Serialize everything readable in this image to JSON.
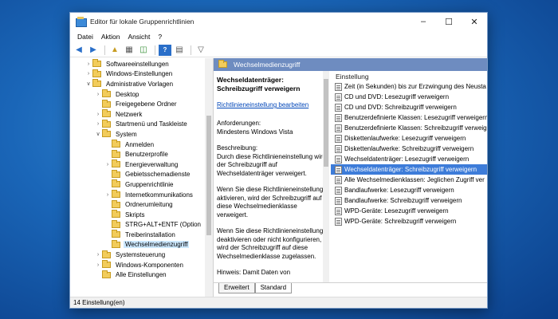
{
  "window": {
    "title": "Editor für lokale Gruppenrichtlinien"
  },
  "menu": [
    "Datei",
    "Aktion",
    "Ansicht",
    "?"
  ],
  "tree": [
    {
      "label": "Softwareeinstellungen",
      "indent": 1,
      "arrow": ">",
      "selected": false
    },
    {
      "label": "Windows-Einstellungen",
      "indent": 1,
      "arrow": ">",
      "selected": false
    },
    {
      "label": "Administrative Vorlagen",
      "indent": 1,
      "arrow": "v",
      "selected": false
    },
    {
      "label": "Desktop",
      "indent": 2,
      "arrow": ">",
      "selected": false
    },
    {
      "label": "Freigegebene Ordner",
      "indent": 2,
      "arrow": "",
      "selected": false
    },
    {
      "label": "Netzwerk",
      "indent": 2,
      "arrow": ">",
      "selected": false
    },
    {
      "label": "Startmenü und Taskleiste",
      "indent": 2,
      "arrow": ">",
      "selected": false
    },
    {
      "label": "System",
      "indent": 2,
      "arrow": "v",
      "selected": false
    },
    {
      "label": "Anmelden",
      "indent": 3,
      "arrow": "",
      "selected": false
    },
    {
      "label": "Benutzerprofile",
      "indent": 3,
      "arrow": "",
      "selected": false
    },
    {
      "label": "Energieverwaltung",
      "indent": 3,
      "arrow": ">",
      "selected": false
    },
    {
      "label": "Gebietsschemadienste",
      "indent": 3,
      "arrow": "",
      "selected": false
    },
    {
      "label": "Gruppenrichtlinie",
      "indent": 3,
      "arrow": "",
      "selected": false
    },
    {
      "label": "Internetkommunikations",
      "indent": 3,
      "arrow": ">",
      "selected": false
    },
    {
      "label": "Ordnerumleitung",
      "indent": 3,
      "arrow": "",
      "selected": false
    },
    {
      "label": "Skripts",
      "indent": 3,
      "arrow": "",
      "selected": false
    },
    {
      "label": "STRG+ALT+ENTF (Option",
      "indent": 3,
      "arrow": "",
      "selected": false
    },
    {
      "label": "Treiberinstallation",
      "indent": 3,
      "arrow": "",
      "selected": false
    },
    {
      "label": "Wechselmedienzugriff",
      "indent": 3,
      "arrow": "",
      "selected": true
    },
    {
      "label": "Systemsteuerung",
      "indent": 2,
      "arrow": ">",
      "selected": false
    },
    {
      "label": "Windows-Komponenten",
      "indent": 2,
      "arrow": ">",
      "selected": false
    },
    {
      "label": "Alle Einstellungen",
      "indent": 2,
      "arrow": "",
      "selected": false
    }
  ],
  "right_header": "Wechselmedienzugriff",
  "desc": {
    "title": "Wechseldatenträger: Schreibzugriff verweigern",
    "link": "Richtlinieneinstellung bearbeiten",
    "req_label": "Anforderungen:",
    "req_value": "Mindestens Windows Vista",
    "desc_label": "Beschreibung:",
    "desc_text": "Durch diese Richtlinieneinstellung wird der Schreibzugriff auf Wechseldatenträger verweigert.",
    "p2": "Wenn Sie diese Richtlinieneinstellung aktivieren, wird der Schreibzugriff auf diese Wechselmedienklasse verweigert.",
    "p3": "Wenn Sie diese Richtlinieneinstellung deaktivieren oder nicht konfigurieren, wird der Schreibzugriff auf diese Wechselmedienklasse zugelassen.",
    "p4": "Hinweis: Damit Daten von"
  },
  "list": {
    "header": "Einstellung",
    "items": [
      {
        "label": "Zeit (in Sekunden) bis zur Erzwingung des Neusta",
        "selected": false
      },
      {
        "label": "CD und DVD: Lesezugriff verweigern",
        "selected": false
      },
      {
        "label": "CD und DVD: Schreibzugriff verweigern",
        "selected": false
      },
      {
        "label": "Benutzerdefinierte Klassen: Lesezugriff verweigern",
        "selected": false
      },
      {
        "label": "Benutzerdefinierte Klassen: Schreibzugriff verweigern",
        "selected": false
      },
      {
        "label": "Diskettenlaufwerke: Lesezugriff verweigern",
        "selected": false
      },
      {
        "label": "Diskettenlaufwerke: Schreibzugriff verweigern",
        "selected": false
      },
      {
        "label": "Wechseldatenträger: Lesezugriff verweigern",
        "selected": false
      },
      {
        "label": "Wechseldatenträger: Schreibzugriff verweigern",
        "selected": true
      },
      {
        "label": "Alle Wechselmedienklassen: Jeglichen Zugriff ver",
        "selected": false
      },
      {
        "label": "Bandlaufwerke: Lesezugriff verweigern",
        "selected": false
      },
      {
        "label": "Bandlaufwerke: Schreibzugriff verweigern",
        "selected": false
      },
      {
        "label": "WPD-Geräte: Lesezugriff verweigern",
        "selected": false
      },
      {
        "label": "WPD-Geräte: Schreibzugriff verweigern",
        "selected": false
      }
    ]
  },
  "tabs": [
    "Erweitert",
    "Standard"
  ],
  "status": "14 Einstellung(en)"
}
